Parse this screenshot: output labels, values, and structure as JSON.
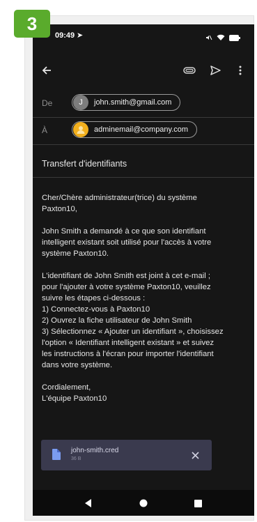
{
  "step": {
    "number": "3",
    "color": "#5aab2c"
  },
  "status_bar": {
    "time": "09:49"
  },
  "toolbar": {
    "back_icon": "arrow-left-icon",
    "attach_icon": "paperclip-icon",
    "send_icon": "send-icon",
    "more_icon": "more-vert-icon"
  },
  "from": {
    "label": "De",
    "avatar_initial": "J",
    "email": "john.smith@gmail.com"
  },
  "to": {
    "label": "À",
    "email": "adminemail@company.com"
  },
  "subject": "Transfert d'identifiants",
  "body": {
    "greeting": [
      "Cher/Chère administrateur(trice) du système",
      "Paxton10,"
    ],
    "para1": [
      "John Smith a demandé à ce que son identifiant",
      "intelligent existant soit utilisé pour l'accès à votre",
      "système Paxton10."
    ],
    "para2": [
      "L'identifiant de John Smith est joint à cet e-mail ;",
      "pour l'ajouter à votre système Paxton10, veuillez",
      "suivre les étapes ci-dessous :",
      "1) Connectez-vous à Paxton10",
      "2) Ouvrez la fiche utilisateur de John Smith",
      "3) Sélectionnez « Ajouter un identifiant », choisissez",
      "l'option « Identifiant intelligent existant » et suivez",
      "les instructions à l'écran pour importer l'identifiant",
      "dans votre système."
    ],
    "signoff": [
      "Cordialement,",
      "L'équipe Paxton10"
    ]
  },
  "attachment": {
    "name": "john-smith.cred",
    "size": "36 B"
  },
  "colors": {
    "screen_bg": "#161616",
    "chip_border": "#9a9a9a",
    "attachment_bg": "#3a3a4e",
    "avatar_from": "#7d7d7d",
    "avatar_to": "#f2b01e"
  }
}
